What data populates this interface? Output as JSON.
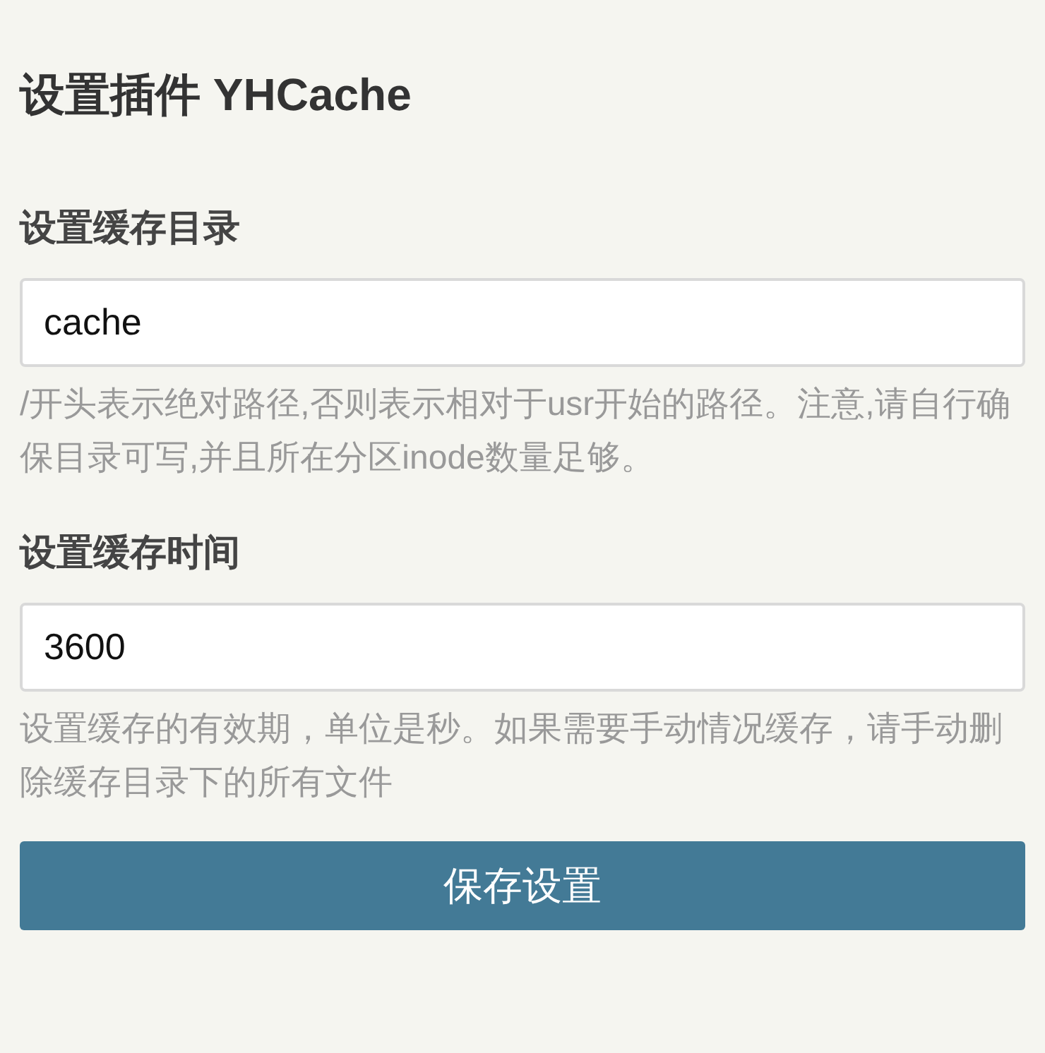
{
  "title": "设置插件 YHCache",
  "fields": [
    {
      "label": "设置缓存目录",
      "value": "cache",
      "hint": "/开头表示绝对路径,否则表示相对于usr开始的路径。注意,请自行确保目录可写,并且所在分区inode数量足够。"
    },
    {
      "label": "设置缓存时间",
      "value": "3600",
      "hint": "设置缓存的有效期，单位是秒。如果需要手动情况缓存，请手动删除缓存目录下的所有文件"
    }
  ],
  "button": "保存设置"
}
